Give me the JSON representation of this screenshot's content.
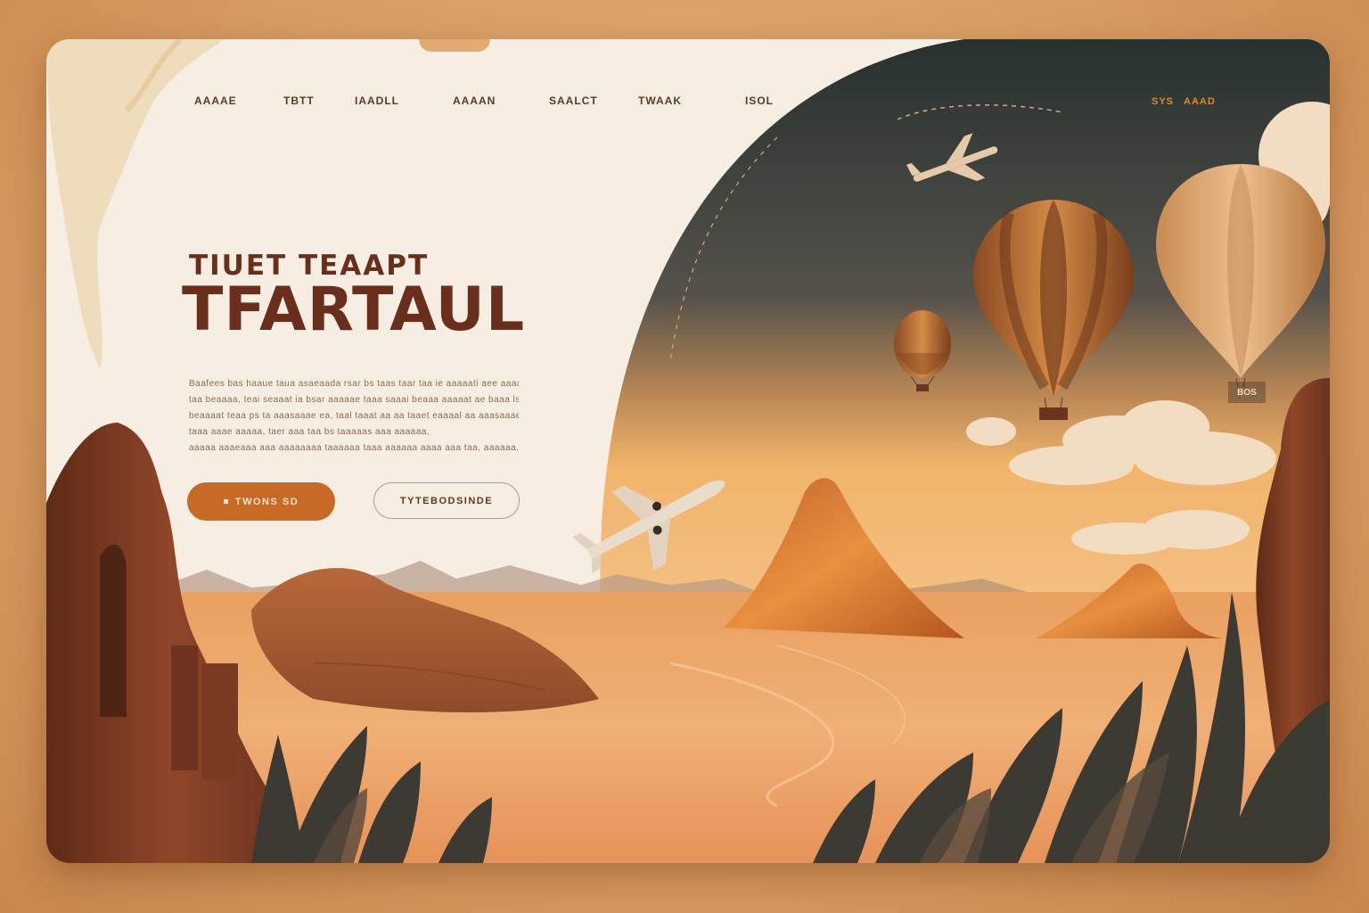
{
  "nav": {
    "items": [
      "AAAAE",
      "TBTT",
      "IAADLL",
      "AAAAN",
      "SAALCT",
      "TWAAK",
      "ISOL"
    ],
    "right_links": [
      "SYS",
      "AAAD"
    ]
  },
  "hero": {
    "subtitle": "TIUET TEAAPT",
    "title": "TFARTAUL",
    "description_lines": [
      "Baafees bas haaue taua asaeaada rsar bs taas taar taa ie aaaaati aee aaaa ia",
      "taa beaaaa, teai seaaat ia bsar aaaaae taaa saaai beaaa aaaaat ae baaa lsaa a aaa. ia",
      "beaaaat teaa ps ta aaasaaae ea, taal taaat aa aa  taaet eaaaal aa aaasaaae taaa ia aaes",
      "taaa aaae aaaaa, taer aaa taa bs taaaaas aaa aaaaaa,",
      "aaaaa aaaeaaa aaa aaaaaaaa taaaaaa taaa aaaaaa aaaa aaa taa, aaaaaa."
    ],
    "primary_button": "TWONS  SD",
    "secondary_button": "TYTEBODSINDE"
  },
  "scene": {
    "balloon_badge": "BOS"
  },
  "colors": {
    "brand": "#6a2f1c",
    "accent": "#c76a25",
    "panel": "#f6eee3",
    "sky_dark": "#2f3a37",
    "sand": "#e99a52"
  }
}
